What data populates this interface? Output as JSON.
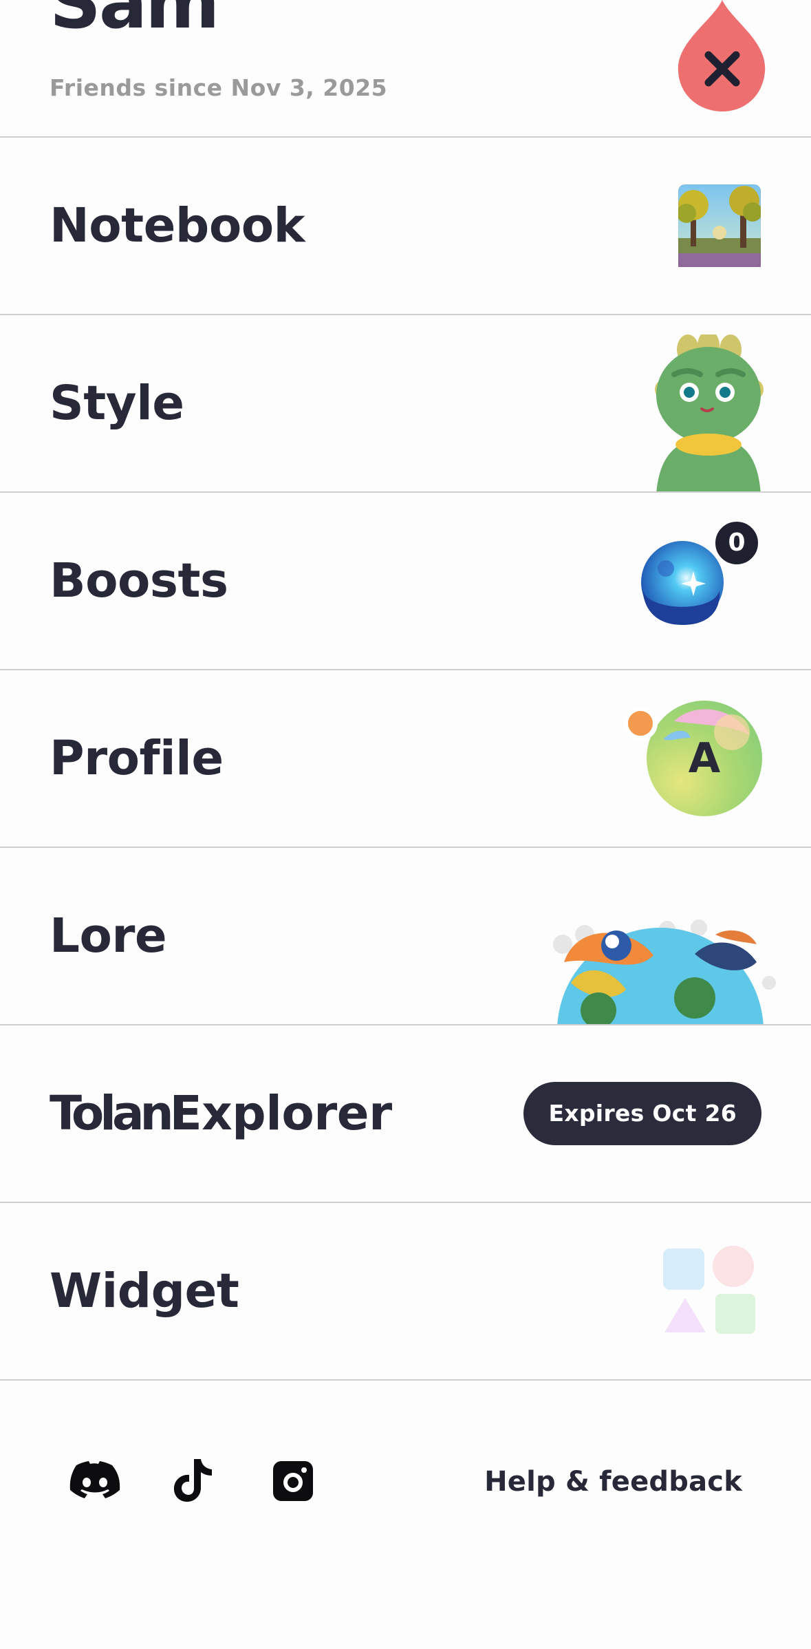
{
  "header": {
    "friend_name": "Sam",
    "friends_since": "Friends since Nov 3, 2025"
  },
  "menu": {
    "notebook": "Notebook",
    "style": "Style",
    "boosts": "Boosts",
    "boosts_count": "0",
    "profile": "Profile",
    "profile_initial": "A",
    "lore": "Lore",
    "tolan_brand": "Tolan",
    "tolan_sub": "Explorer",
    "explorer_expires": "Expires Oct 26",
    "widget": "Widget"
  },
  "footer": {
    "help_label": "Help & feedback",
    "social_icons": [
      "discord-icon",
      "tiktok-icon",
      "instagram-icon"
    ]
  },
  "colors": {
    "text_primary": "#272838",
    "text_muted": "#9a9a9a",
    "divider": "#cfcfd2",
    "pill_bg": "#2a2b3b",
    "close_flame": "#ee6f6f",
    "profile_dot": "#f39a4f"
  }
}
